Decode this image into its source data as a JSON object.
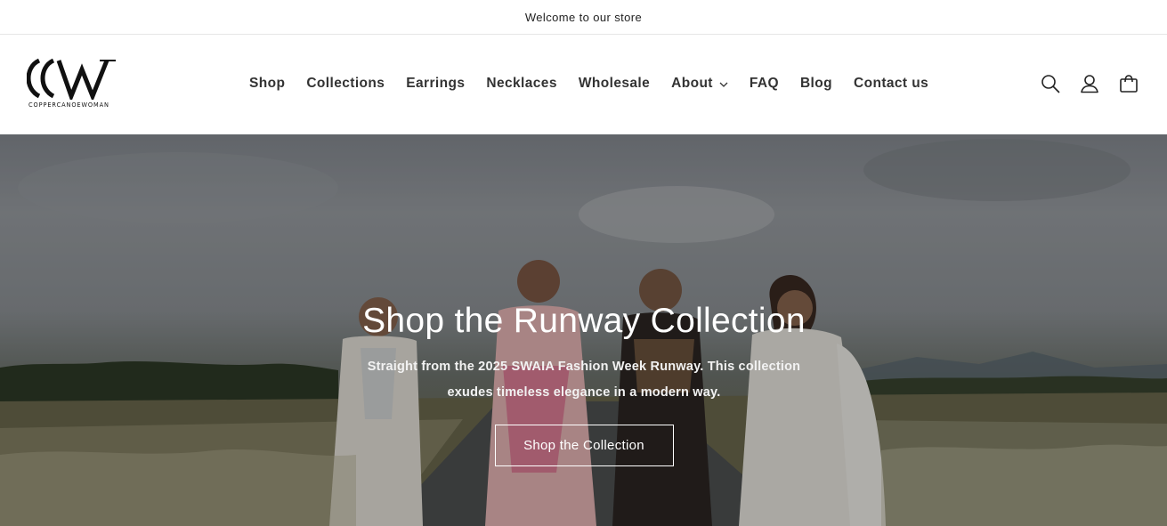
{
  "announcement": {
    "text": "Welcome to our store"
  },
  "brand": {
    "logo_text": "COPPERCANOEWOMAN"
  },
  "nav": {
    "items": [
      {
        "label": "Shop"
      },
      {
        "label": "Collections"
      },
      {
        "label": "Earrings"
      },
      {
        "label": "Necklaces"
      },
      {
        "label": "Wholesale"
      },
      {
        "label": "About"
      },
      {
        "label": "FAQ"
      },
      {
        "label": "Blog"
      },
      {
        "label": "Contact us"
      }
    ]
  },
  "header_icons": [
    "search-icon",
    "account-icon",
    "cart-icon"
  ],
  "hero": {
    "title": "Shop the Runway Collection",
    "subtitle": "Straight from the 2025 SWAIA Fashion Week Runway. This collection exudes timeless elegance in a modern way.",
    "button_label": "Shop the Collection"
  },
  "colors": {
    "text": "#121212",
    "nav_text": "#333333",
    "hero_text": "#ffffff",
    "divider": "#e6e6e6"
  }
}
